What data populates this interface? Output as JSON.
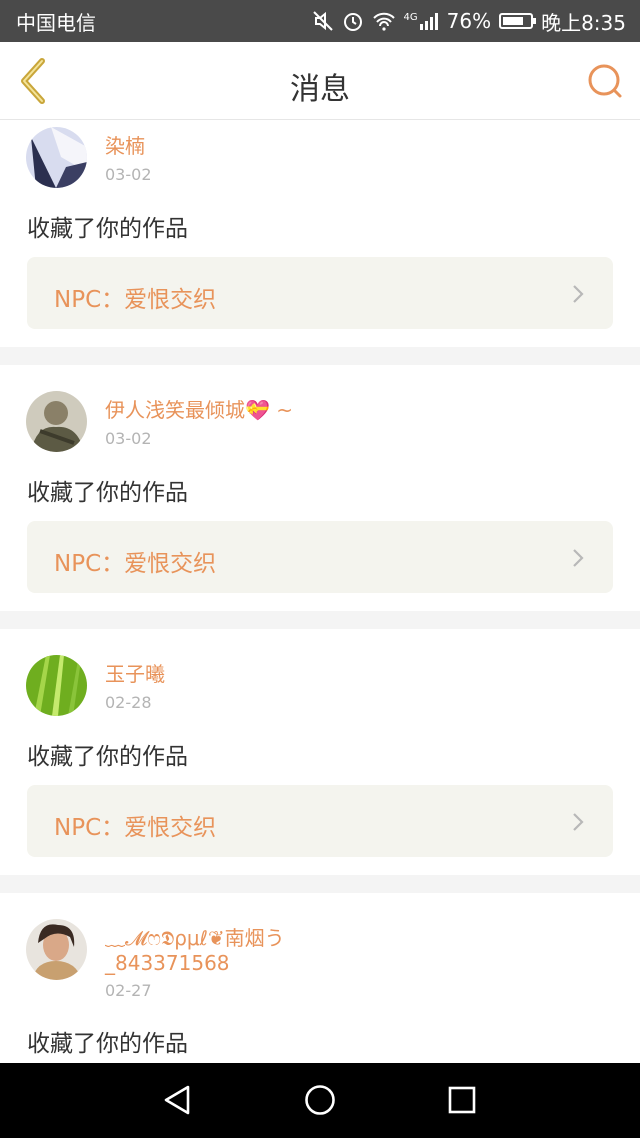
{
  "status_bar": {
    "carrier": "中国电信",
    "network": "4G",
    "battery": "76%",
    "battery_level": 0.76,
    "time": "晚上8:35"
  },
  "header": {
    "title": "消息",
    "back_icon": "chevron-left-icon",
    "search_icon": "search-icon"
  },
  "messages": [
    {
      "user": "染楠",
      "date": "03-02",
      "action": "收藏了你的作品",
      "work": "NPC：爱恨交织"
    },
    {
      "user": "伊人浅笑最倾城💝 ~",
      "date": "03-02",
      "action": "收藏了你的作品",
      "work": "NPC：爱恨交织"
    },
    {
      "user": "玉子曦",
      "date": "02-28",
      "action": "收藏了你的作品",
      "work": "NPC：爱恨交织"
    },
    {
      "user": "﹏𝓜ෆ𝕯ρμℓ❦南烟う",
      "user_line2": "_843371568",
      "date": "02-27",
      "action": "收藏了你的作品"
    }
  ],
  "colors": {
    "accent": "#e8935a",
    "status_bar": "#4a4a4a",
    "link_bg": "#f4f4ee",
    "back_icon": "#c9a63a"
  }
}
